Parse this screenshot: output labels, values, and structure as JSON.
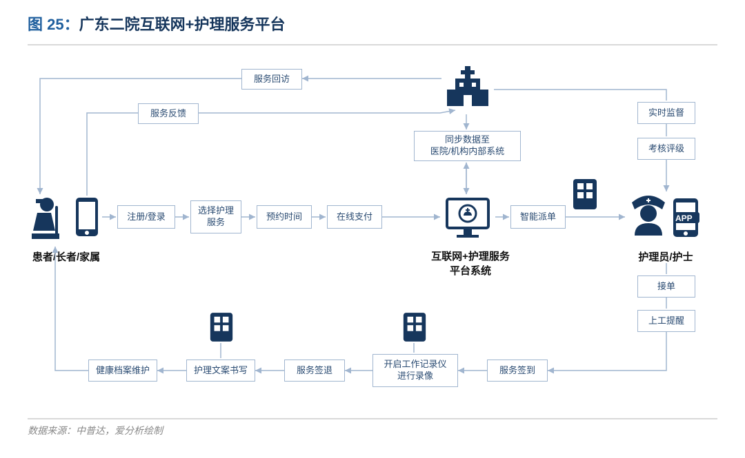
{
  "title_prefix": "图 25：",
  "title_main": "广东二院互联网+护理服务平台",
  "footer": "数据来源：中普达，爱分析绘制",
  "labels": {
    "patient": "患者/长者/家属",
    "platform_l1": "互联网+护理服务",
    "platform_l2": "平台系统",
    "nurse": "护理员/护士"
  },
  "boxes": {
    "service_revisit": "服务回访",
    "service_feedback": "服务反馈",
    "register_login": "注册/登录",
    "choose_service": "选择护理\n服务",
    "book_time": "预约时间",
    "online_pay": "在线支付",
    "sync_data_l1": "同步数据至",
    "sync_data_l2": "医院/机构内部系统",
    "smart_dispatch": "智能派单",
    "realtime_supervise": "实时监督",
    "assess_rating": "考核评级",
    "take_order": "接单",
    "work_reminder": "上工提醒",
    "health_record": "健康档案维护",
    "nursing_doc": "护理文案书写",
    "service_checkout": "服务签退",
    "recorder_l1": "开启工作记录仪",
    "recorder_l2": "进行录像",
    "service_checkin": "服务签到"
  },
  "app_label": "APP"
}
